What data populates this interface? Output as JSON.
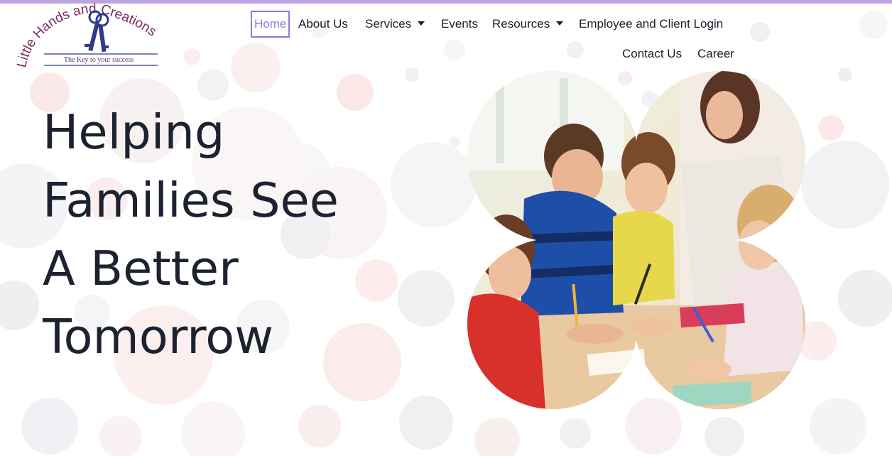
{
  "logo": {
    "arc_text": "Little Hands and Creations",
    "tagline": "The Key to your success",
    "icon": "keys-icon"
  },
  "nav": {
    "items": [
      {
        "label": "Home",
        "active": true
      },
      {
        "label": "About Us"
      },
      {
        "label": "Services",
        "dropdown": true
      },
      {
        "label": "Events"
      },
      {
        "label": "Resources",
        "dropdown": true
      },
      {
        "label": "Employee and Client Login"
      },
      {
        "label": "Contact Us"
      },
      {
        "label": "Career"
      }
    ],
    "accent_color": "#8b7bd6"
  },
  "hero": {
    "title_lines": [
      "Helping",
      "Families See",
      "A Better",
      "Tomorrow"
    ],
    "image_subject": "teacher-with-children-photo"
  },
  "colors": {
    "brand_purple": "#8b7bd6",
    "logo_text": "#7a2a63",
    "title_text": "#1c2230"
  }
}
